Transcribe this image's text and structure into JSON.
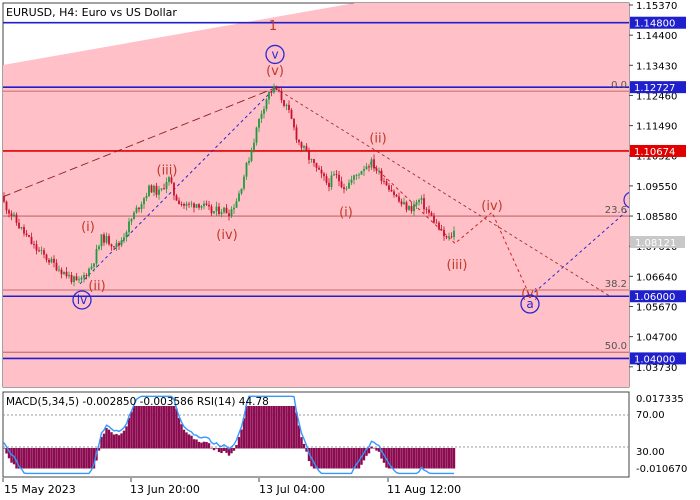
{
  "header": {
    "title": "EURUSD, H4:  Euro vs US Dollar"
  },
  "indicator": {
    "label": "MACD(5,34,5) -0.002850 -0.003586 RSI(14) 44.78"
  },
  "colors": {
    "bull": "#1f9a3e",
    "bear": "#c8102e",
    "level_blue": "#1f1fcc",
    "level_red": "#e00000",
    "wave_text": "#c0392b",
    "wave_blue": "#2a2ad0",
    "zone_fill": "#ffc0c8",
    "macd": "#8b0a50",
    "rsi": "#3399ff"
  },
  "chart_data": {
    "type": "candlestick",
    "symbol": "EURUSD",
    "timeframe": "H4",
    "ylim": [
      1.0308,
      1.1537
    ],
    "y_ticks": [
      1.1537,
      1.144,
      1.1343,
      1.1246,
      1.1149,
      1.1052,
      1.0955,
      1.0858,
      1.0761,
      1.0664,
      1.0567,
      1.047,
      1.0373
    ],
    "x_ticks": [
      "15 May 2023",
      "13 Jun 20:00",
      "13 Jul 04:00",
      "11 Aug 12:00"
    ],
    "current_price": "1.08121",
    "price_path": [
      [
        0,
        1.092
      ],
      [
        18,
        1.083
      ],
      [
        35,
        1.0755
      ],
      [
        55,
        1.07
      ],
      [
        78,
        1.064
      ],
      [
        92,
        1.07
      ],
      [
        102,
        1.079
      ],
      [
        118,
        1.076
      ],
      [
        135,
        1.087
      ],
      [
        150,
        1.095
      ],
      [
        160,
        1.093
      ],
      [
        168,
        1.0985
      ],
      [
        175,
        1.092
      ],
      [
        185,
        1.089
      ],
      [
        198,
        1.09
      ],
      [
        212,
        1.087
      ],
      [
        222,
        1.088
      ],
      [
        230,
        1.087
      ],
      [
        238,
        1.092
      ],
      [
        245,
        1.1
      ],
      [
        252,
        1.108
      ],
      [
        260,
        1.118
      ],
      [
        268,
        1.125
      ],
      [
        275,
        1.127
      ],
      [
        283,
        1.123
      ],
      [
        290,
        1.118
      ],
      [
        298,
        1.11
      ],
      [
        308,
        1.105
      ],
      [
        318,
        1.1
      ],
      [
        328,
        1.096
      ],
      [
        335,
        1.099
      ],
      [
        345,
        1.095
      ],
      [
        355,
        1.0985
      ],
      [
        365,
        1.102
      ],
      [
        372,
        1.103
      ],
      [
        380,
        1.099
      ],
      [
        390,
        1.095
      ],
      [
        400,
        1.09
      ],
      [
        410,
        1.088
      ],
      [
        420,
        1.091
      ],
      [
        428,
        1.087
      ],
      [
        435,
        1.084
      ],
      [
        442,
        1.08
      ],
      [
        448,
        1.078
      ],
      [
        455,
        1.0812
      ]
    ],
    "levels": [
      {
        "price": 1.148,
        "label": "1.14800",
        "color": "blue"
      },
      {
        "price": 1.12727,
        "label": "1.12727",
        "color": "blue"
      },
      {
        "price": 1.10674,
        "label": "1.10674",
        "color": "red"
      },
      {
        "price": 1.06,
        "label": "1.06000",
        "color": "blue"
      },
      {
        "price": 1.04,
        "label": "1.04000",
        "color": "blue"
      }
    ],
    "fib_levels": [
      {
        "price": 1.126,
        "label": "0.0"
      },
      {
        "price": 1.0858,
        "label": "23.6"
      },
      {
        "price": 1.062,
        "label": "38.2"
      },
      {
        "price": 1.042,
        "label": "50.0"
      }
    ],
    "wave_labels": [
      {
        "text": "1",
        "x": 273,
        "price": 1.147,
        "style": "plain"
      },
      {
        "text": "v",
        "x": 275,
        "price": 1.1378,
        "style": "circle"
      },
      {
        "text": "(v)",
        "x": 275,
        "price": 1.1324,
        "style": "plain"
      },
      {
        "text": "(iii)",
        "x": 167,
        "price": 1.1005,
        "style": "plain"
      },
      {
        "text": "(i)",
        "x": 88,
        "price": 1.0822,
        "style": "plain"
      },
      {
        "text": "(ii)",
        "x": 97,
        "price": 1.0633,
        "style": "plain"
      },
      {
        "text": "iv",
        "x": 82,
        "price": 1.0588,
        "style": "circle"
      },
      {
        "text": "(iv)",
        "x": 227,
        "price": 1.0797,
        "style": "plain"
      },
      {
        "text": "(ii)",
        "x": 378,
        "price": 1.1108,
        "style": "plain"
      },
      {
        "text": "(i)",
        "x": 346,
        "price": 1.087,
        "style": "plain"
      },
      {
        "text": "(iii)",
        "x": 457,
        "price": 1.07,
        "style": "plain"
      },
      {
        "text": "(iv)",
        "x": 492,
        "price": 1.089,
        "style": "plain"
      },
      {
        "text": "(v)",
        "x": 530,
        "price": 1.0608,
        "style": "plain"
      },
      {
        "text": "a",
        "x": 530,
        "price": 1.0575,
        "style": "circle"
      }
    ],
    "legend": "none",
    "grid": false
  },
  "macd_panel": {
    "y_ticks": [
      "0.017335",
      "70.00",
      "30.00",
      "-0.010670"
    ]
  }
}
